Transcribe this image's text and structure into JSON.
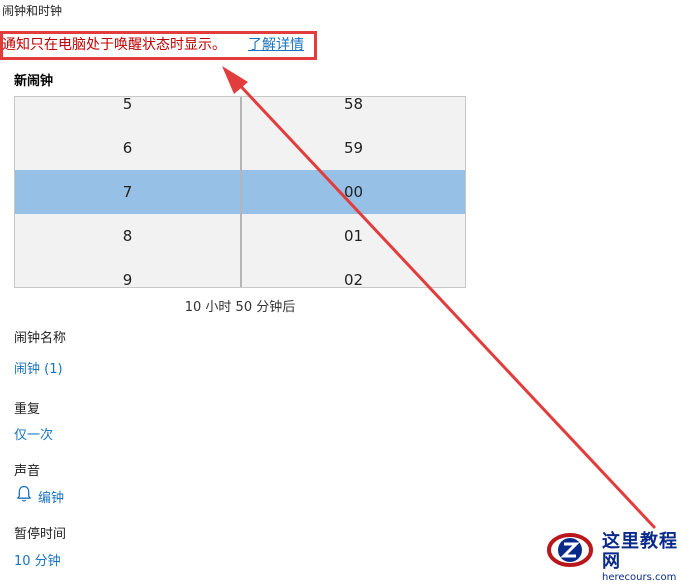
{
  "app": {
    "title": "闹钟和时钟"
  },
  "notice": {
    "text": "通知只在电脑处于唤醒状态时显示。",
    "link": "了解详情"
  },
  "new_alarm": {
    "heading": "新闹钟"
  },
  "time_picker": {
    "hours": [
      "5",
      "6",
      "7",
      "8",
      "9"
    ],
    "minutes": [
      "58",
      "59",
      "00",
      "01",
      "02"
    ],
    "selected_hour": "7",
    "selected_minute": "00"
  },
  "countdown": "10 小时 50 分钟后",
  "fields": {
    "name_label": "闹钟名称",
    "name_value": "闹钟 (1)",
    "repeat_label": "重复",
    "repeat_value": "仅一次",
    "sound_label": "声音",
    "sound_icon": "bell-icon",
    "sound_value": "编钟",
    "snooze_label": "暂停时间",
    "snooze_value": "10 分钟"
  },
  "watermark": {
    "cn": "这里教程网",
    "url": "herecours.com"
  },
  "colors": {
    "accent": "#1a73c0",
    "selection": "#96c0e6",
    "highlight_red": "#e23c3c"
  }
}
